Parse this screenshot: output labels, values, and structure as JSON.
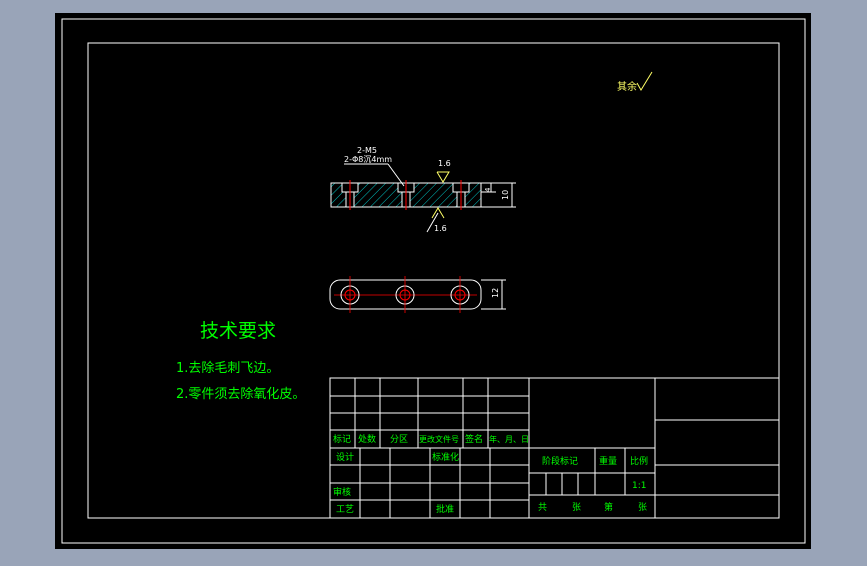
{
  "annotations": {
    "roughness_rest": "其余",
    "hole_callout_line1": "2-M5",
    "hole_callout_line2": "2-Φ8沉4mm",
    "roughness_top": "1.6",
    "roughness_bottom": "1.6",
    "dim_height_small": "4",
    "dim_height_total": "10",
    "dim_width_plan": "12"
  },
  "tech_requirements": {
    "title": "技术要求",
    "item1": "1.去除毛刺飞边。",
    "item2": "2.零件须去除氧化皮。"
  },
  "title_block": {
    "mark": "标记",
    "count": "处数",
    "zone": "分区",
    "change_doc": "更改文件号",
    "signature": "签名",
    "date": "年、月、日",
    "design": "设计",
    "standardization": "标准化",
    "review": "审核",
    "process": "工艺",
    "approve": "批准",
    "stage_mark": "阶段标记",
    "weight": "重量",
    "scale": "比例",
    "scale_value": "1:1",
    "total": "共",
    "sheet": "张",
    "number": "第",
    "sheet2": "张"
  },
  "colors": {
    "background": "#000000",
    "frame": "#ffffff",
    "text_green": "#00ff00",
    "annotation_green": "#00ff00",
    "hole_red": "#ff0000",
    "hatch_cyan": "#00ffff",
    "text_yellowish": "#ffff66"
  }
}
